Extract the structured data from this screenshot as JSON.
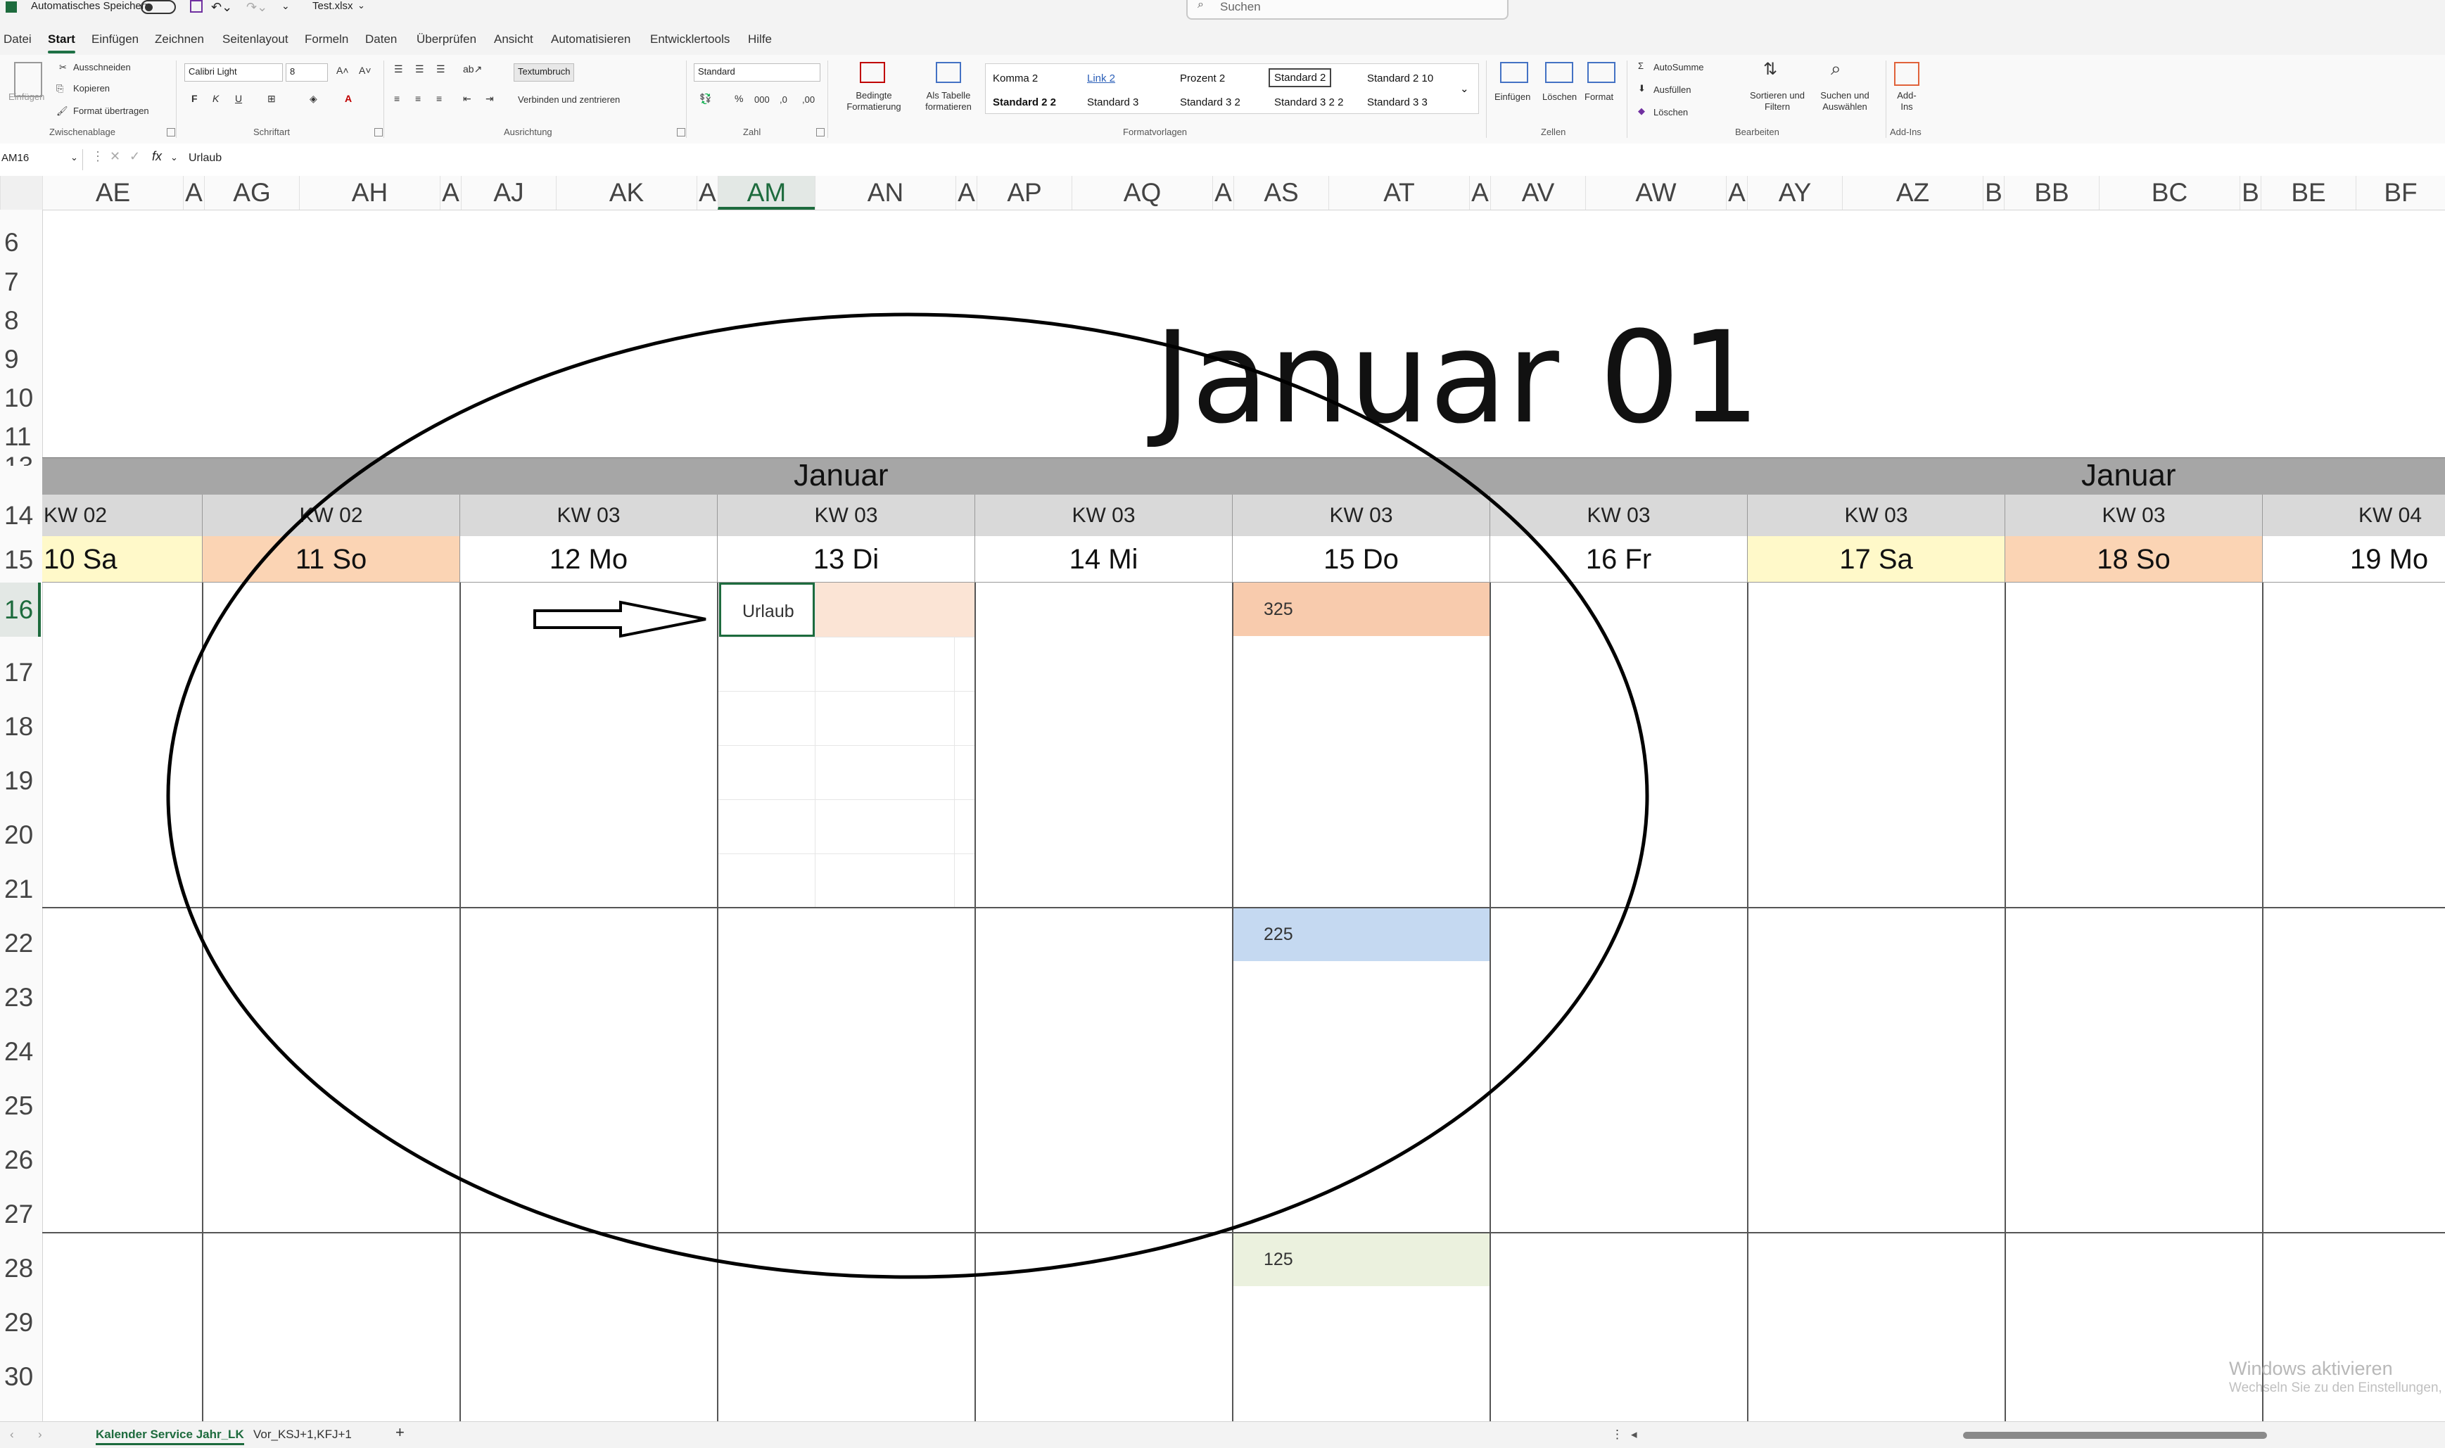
{
  "titlebar": {
    "autosave_label": "Automatisches Speichern",
    "filename": "Test.xlsx",
    "search_placeholder": "Suchen"
  },
  "menu": [
    "Datei",
    "Start",
    "Einfügen",
    "Zeichnen",
    "Seitenlayout",
    "Formeln",
    "Daten",
    "Überprüfen",
    "Ansicht",
    "Automatisieren",
    "Entwicklertools",
    "Hilfe"
  ],
  "menu_active": "Start",
  "ribbon": {
    "clipboard": {
      "paste": "Einfügen",
      "cut": "Ausschneiden",
      "copy": "Kopieren",
      "format_painter": "Format übertragen",
      "label": "Zwischenablage"
    },
    "font": {
      "name": "Calibri Light",
      "size": "8",
      "bold": "F",
      "italic": "K",
      "underline": "U",
      "label": "Schriftart"
    },
    "alignment": {
      "wrap": "Textumbruch",
      "merge": "Verbinden und zentrieren",
      "label": "Ausrichtung"
    },
    "number": {
      "format": "Standard",
      "label": "Zahl"
    },
    "styles": {
      "conditional": "Bedingte Formatierung",
      "as_table": "Als Tabelle formatieren",
      "label": "Formatvorlagen",
      "cells": [
        "Komma 2",
        "Link 2",
        "Prozent 2",
        "Standard 2",
        "Standard 2 10",
        "Standard 2 2",
        "Standard 3",
        "Standard 3 2",
        "Standard 3 2 2",
        "Standard 3 3"
      ]
    },
    "cells": {
      "insert": "Einfügen",
      "delete": "Löschen",
      "format": "Format",
      "label": "Zellen"
    },
    "editing": {
      "autosum": "AutoSumme",
      "fill": "Ausfüllen",
      "clear": "Löschen",
      "sort": "Sortieren und Filtern",
      "find": "Suchen und Auswählen",
      "label": "Bearbeiten"
    },
    "addins": {
      "button": "Add-Ins",
      "label": "Add-Ins"
    }
  },
  "formula_bar": {
    "cell_ref": "AM16",
    "fx": "fx",
    "content": "Urlaub"
  },
  "columns": [
    "AE",
    "A",
    "AG",
    "AH",
    "A",
    "AJ",
    "AK",
    "A",
    "AM",
    "AN",
    "A",
    "AP",
    "AQ",
    "A",
    "AS",
    "AT",
    "A",
    "AV",
    "AW",
    "A",
    "AY",
    "AZ",
    "B",
    "BB",
    "BC",
    "B",
    "BE",
    "BF"
  ],
  "selected_column": "AM",
  "rows": [
    "6",
    "7",
    "8",
    "9",
    "10",
    "11",
    "13",
    "14",
    "15",
    "16",
    "17",
    "18",
    "19",
    "20",
    "21",
    "22",
    "23",
    "24",
    "25",
    "26",
    "27",
    "28",
    "29",
    "30"
  ],
  "selected_row": "16",
  "sheet": {
    "title": "Januar 01",
    "month_labels": [
      "Januar",
      "Januar"
    ],
    "weeks": [
      "KW 02",
      "KW 02",
      "KW 03",
      "KW 03",
      "KW 03",
      "KW 03",
      "KW 03",
      "KW 03",
      "KW 03",
      "KW 04"
    ],
    "days": [
      "10 Sa",
      "11 So",
      "12 Mo",
      "13 Di",
      "14 Mi",
      "15 Do",
      "16 Fr",
      "17 Sa",
      "18 So",
      "19 Mo"
    ],
    "day_colors": [
      "#fff9c9",
      "#fbd4b4",
      "#ffffff",
      "#ffffff",
      "#ffffff",
      "#ffffff",
      "#ffffff",
      "#fff9c9",
      "#fbd4b4",
      "#ffffff"
    ],
    "entries": {
      "urlaub": "Urlaub",
      "v325": "325",
      "v225": "225",
      "v125": "125"
    },
    "entry_colors": {
      "urlaub": "#fbe4d5",
      "v325": "#f8cbad",
      "v225": "#c5d9f1",
      "v125": "#ebf1de"
    }
  },
  "sheet_tabs": [
    "Kalender Service Jahr_LK",
    "Vor_KSJ+1,KFJ+1"
  ],
  "add_sheet": "+",
  "watermark": {
    "title": "Windows aktivieren",
    "subtitle": "Wechseln Sie zu den Einstellungen, um"
  }
}
